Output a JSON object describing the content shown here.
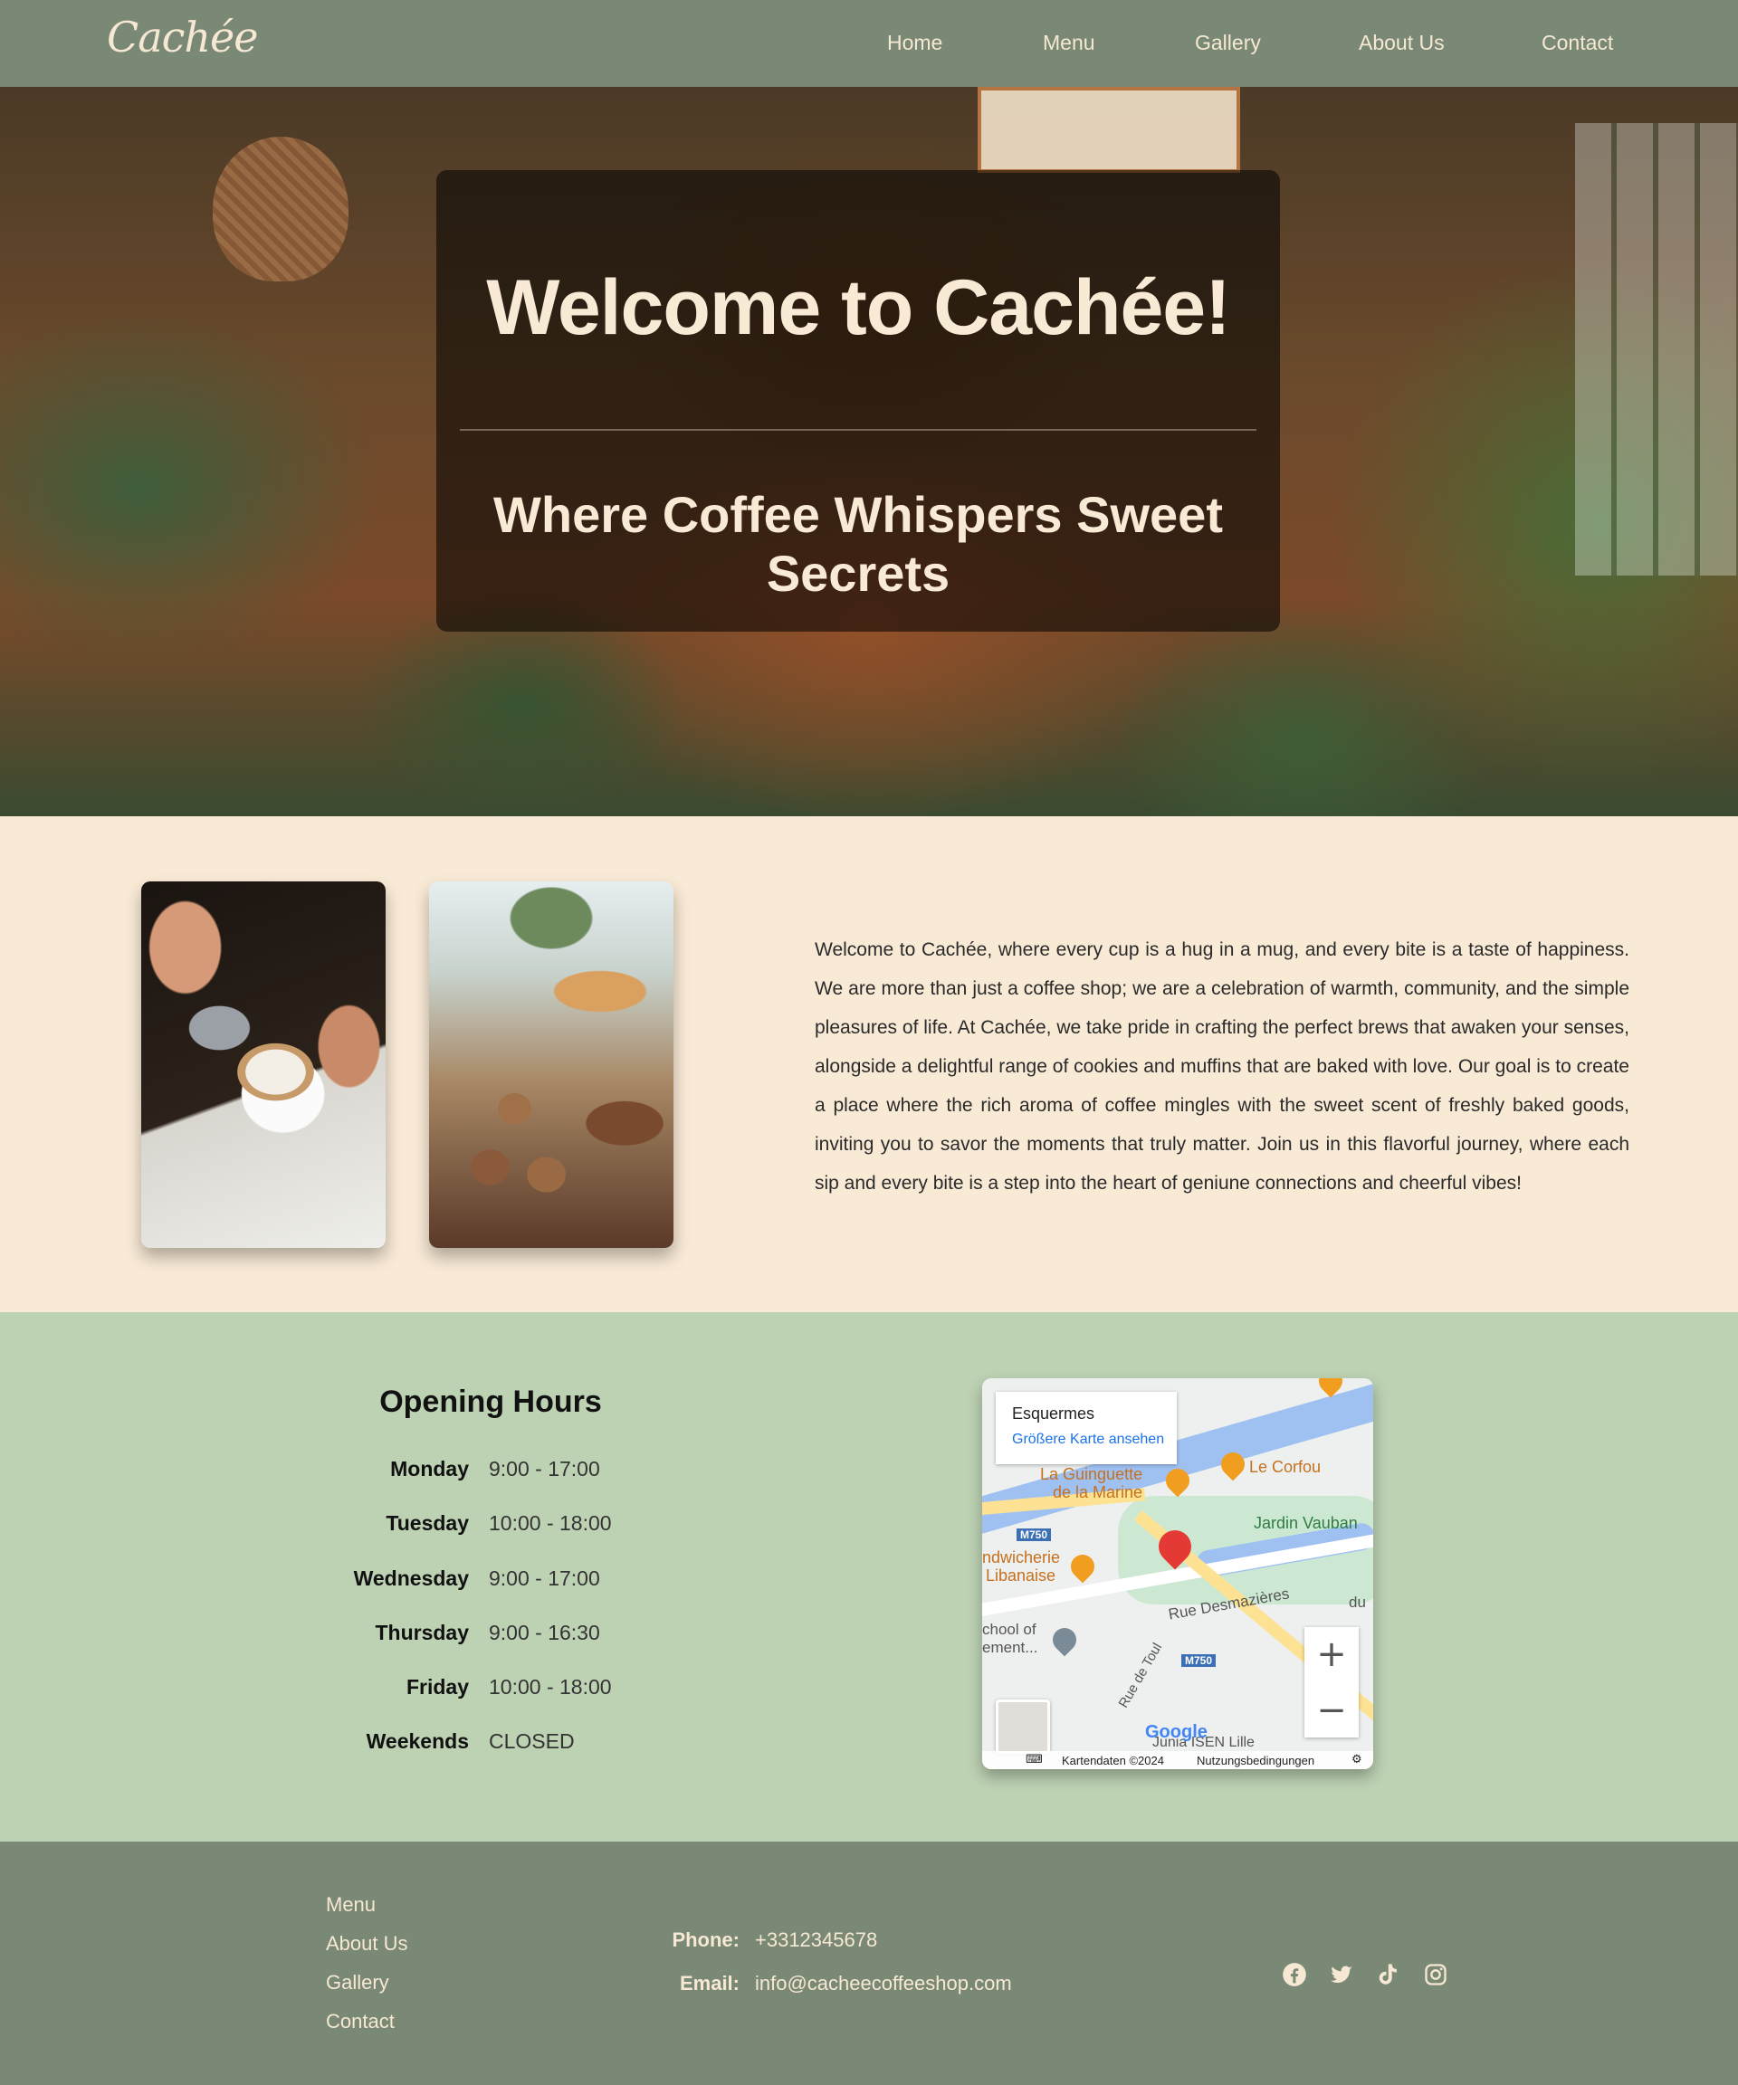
{
  "nav": {
    "logo": "Cachée",
    "items": [
      "Home",
      "Menu",
      "Gallery",
      "About Us",
      "Contact"
    ]
  },
  "hero": {
    "title": "Welcome to Cachée!",
    "subtitle": "Where Coffee Whispers Sweet Secrets"
  },
  "about": {
    "text": "Welcome to Cachée, where every cup is a hug in a mug, and every bite is a taste of happiness. We are more than just a coffee shop; we are a celebration of warmth, community, and the simple pleasures of life. At Cachée, we take pride in crafting the perfect brews that awaken your senses, alongside a delightful range of cookies and muffins that are baked with love. Our goal is to create a place where the rich aroma of coffee mingles with the sweet scent of freshly baked goods, inviting you to savor the moments that truly matter. Join us in this flavorful journey, where each sip and every bite is a step into the heart of geniune connections and cheerful vibes!"
  },
  "hours": {
    "title": "Opening Hours",
    "rows": [
      {
        "day": "Monday",
        "time": "9:00 - 17:00"
      },
      {
        "day": "Tuesday",
        "time": "10:00 - 18:00"
      },
      {
        "day": "Wednesday",
        "time": "9:00 - 17:00"
      },
      {
        "day": "Thursday",
        "time": "9:00 - 16:30"
      },
      {
        "day": "Friday",
        "time": "10:00 - 18:00"
      },
      {
        "day": "Weekends",
        "time": "CLOSED"
      }
    ]
  },
  "map": {
    "place": "Esquermes",
    "larger_map_link": "Größere Karte ansehen",
    "labels": {
      "guinguette": "La Guinguette",
      "marine": "de la Marine",
      "corfou": "Le Corfou",
      "jardin": "Jardin Vauban",
      "sandwich": "ndwicherie",
      "libanaise": "Libanaise",
      "school": "chool of",
      "ement": "ement...",
      "desmazieres": "Rue Desmazières",
      "toul": "Rue de Toul",
      "isen": "Junia ISEN Lille",
      "du": "du",
      "m750": "M750"
    },
    "zoom_in": "+",
    "zoom_out": "−",
    "google": "Google",
    "attribution": "Kartendaten ©2024",
    "terms": "Nutzungsbedingungen"
  },
  "footer": {
    "links": [
      "Menu",
      "About Us",
      "Gallery",
      "Contact"
    ],
    "phone_label": "Phone:",
    "phone": "+3312345678",
    "email_label": "Email:",
    "email": "info@cacheecoffeeshop.com",
    "social": [
      "facebook-icon",
      "twitter-icon",
      "tiktok-icon",
      "instagram-icon"
    ]
  }
}
